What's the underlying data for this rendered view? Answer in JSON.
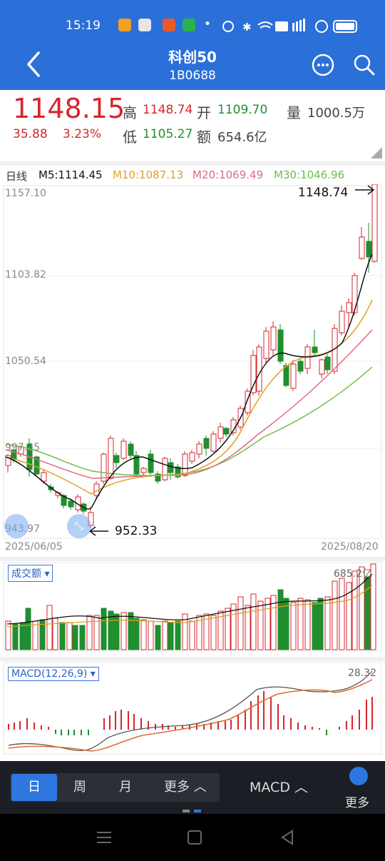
{
  "status_bar": {
    "time": "15:19"
  },
  "header": {
    "title": "科创50",
    "code": "1B0688"
  },
  "quote": {
    "price": "1148.15",
    "change": "35.88",
    "change_pct": "3.23%",
    "high_label": "高",
    "high": "1148.74",
    "open_label": "开",
    "open": "1109.70",
    "vol_label": "量",
    "vol": "1000.5万",
    "low_label": "低",
    "low": "1105.27",
    "amt_label": "额",
    "amt": "654.6亿"
  },
  "ma_legend": {
    "period": "日线",
    "m5": "M5:1114.45",
    "m10": "M10:1087.13",
    "m20": "M20:1069.49",
    "m30": "M30:1046.96"
  },
  "price_chart": {
    "y_top": "1157.10",
    "y_mid1": "1103.82",
    "y_mid2": "1050.54",
    "y_mid3": "997.25",
    "y_bottom": "943.97",
    "max_label": "1148.74",
    "min_label": "952.33",
    "date_start": "2025/06/05",
    "date_end": "2025/08/20"
  },
  "volume_chart": {
    "label": "成交额",
    "max_value": "685.2亿"
  },
  "macd_chart": {
    "label": "MACD(12,26,9)",
    "max_value": "28.32"
  },
  "toolbar": {
    "tab_day": "日",
    "tab_week": "周",
    "tab_month": "月",
    "tab_more": "更多",
    "indicator": "MACD",
    "more": "更多"
  },
  "colors": {
    "brand": "#2b6fd9",
    "up": "#d6262c",
    "down": "#1f8f2f",
    "m5": "#111111",
    "m10": "#e0a020",
    "m20": "#e06a80",
    "m30": "#6bbf4a"
  }
}
